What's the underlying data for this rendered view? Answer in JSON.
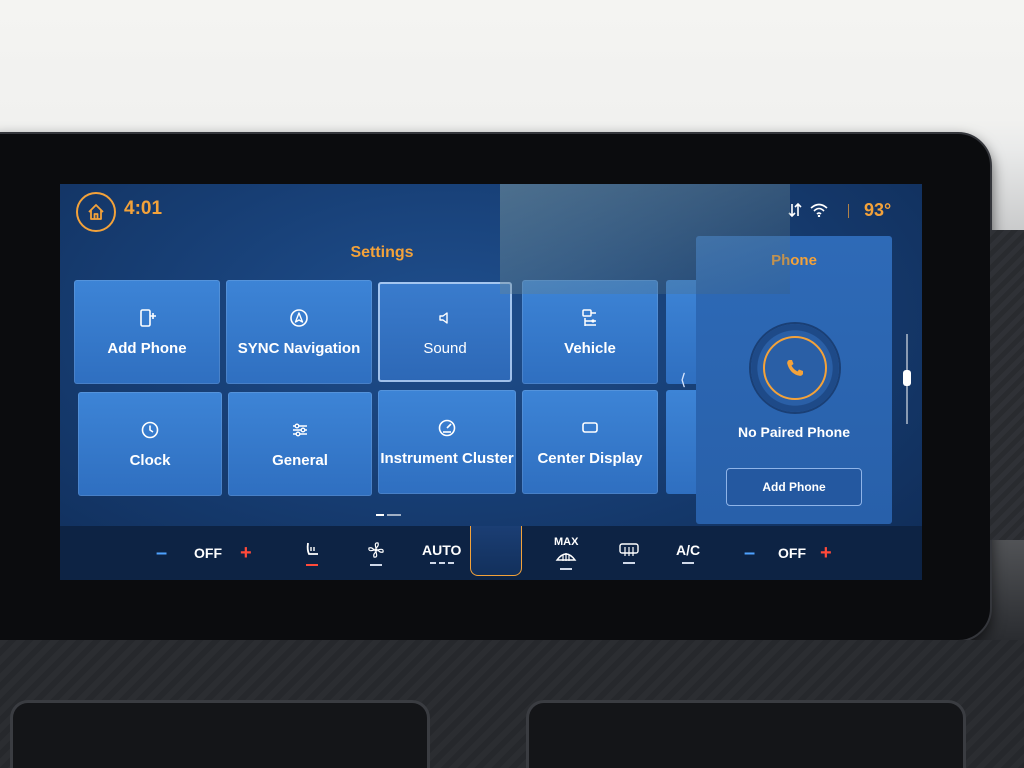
{
  "status_bar": {
    "time": "4:01",
    "temperature": "93°",
    "accent_color": "#f3a23a",
    "icons": [
      "home-icon",
      "data-transfer-icon",
      "wifi-icon"
    ]
  },
  "settings": {
    "title": "Settings",
    "tiles": [
      {
        "label": "Add Phone",
        "icon": "add-phone-icon"
      },
      {
        "label": "SYNC Navigation",
        "icon": "navigation-icon"
      },
      {
        "label": "Sound",
        "icon": "speaker-icon",
        "selected": true
      },
      {
        "label": "Vehicle",
        "icon": "vehicle-settings-icon"
      },
      {
        "label": "Clock",
        "icon": "clock-icon"
      },
      {
        "label": "General",
        "icon": "sliders-icon"
      },
      {
        "label": "Instrument Cluster",
        "icon": "gauge-icon"
      },
      {
        "label": "Center Display",
        "icon": "display-icon"
      }
    ]
  },
  "phone": {
    "title": "Phone",
    "status": "No Paired Phone",
    "button_label": "Add Phone"
  },
  "climate": {
    "left_minus": "–",
    "left_temp": "OFF",
    "left_plus": "+",
    "auto_label": "AUTO",
    "max_label": "MAX",
    "ac_label": "A/C",
    "right_minus": "–",
    "right_temp": "OFF",
    "right_plus": "+"
  }
}
